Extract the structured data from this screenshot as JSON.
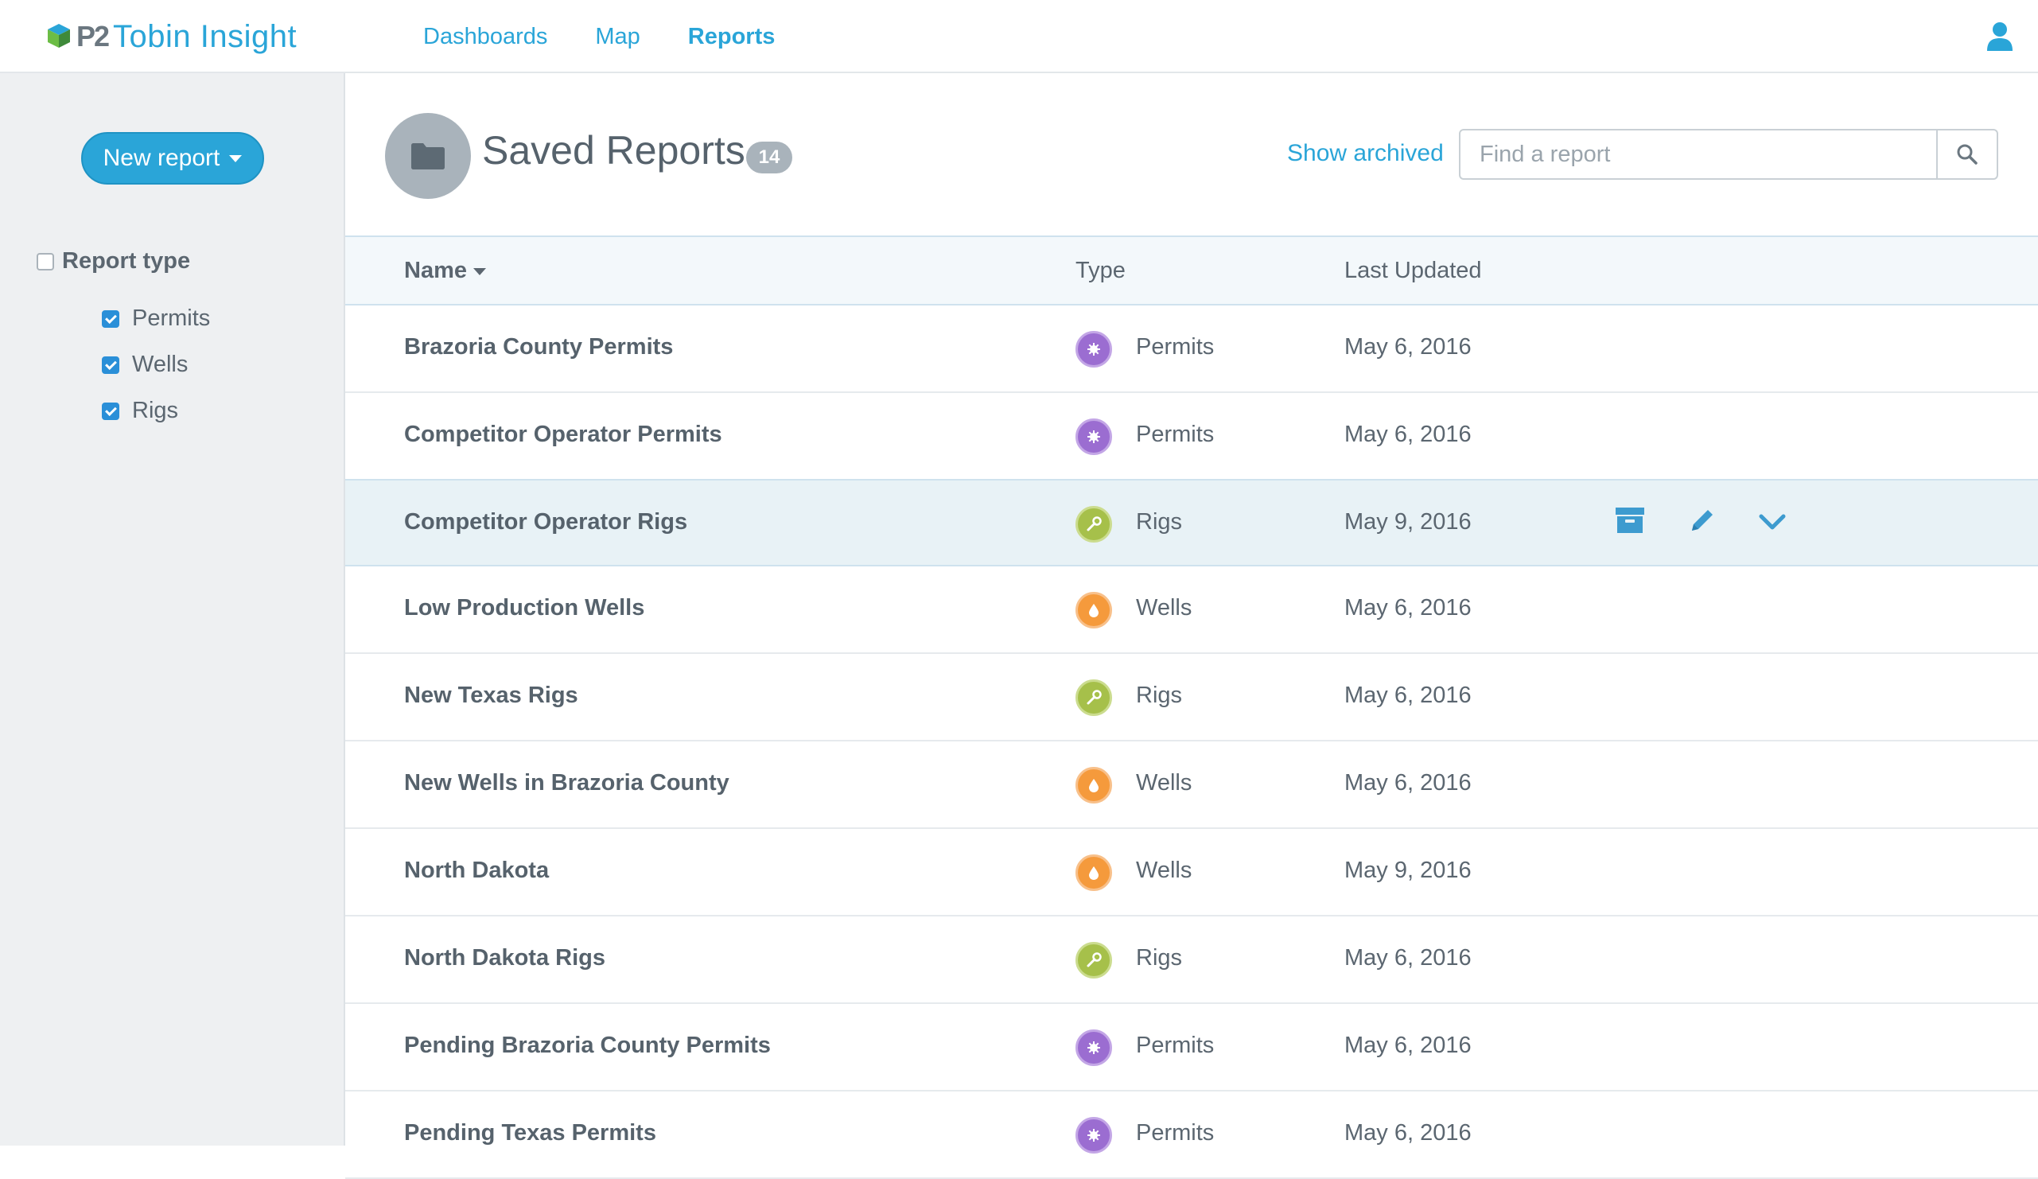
{
  "app": {
    "logo_mark": "P2",
    "logo_name": "Tobin Insight"
  },
  "nav": {
    "items": [
      {
        "label": "Dashboards",
        "active": false
      },
      {
        "label": "Map",
        "active": false
      },
      {
        "label": "Reports",
        "active": true
      }
    ]
  },
  "sidebar": {
    "new_report_label": "New report",
    "filter_title": "Report type",
    "filters": [
      {
        "label": "Permits",
        "checked": true
      },
      {
        "label": "Wells",
        "checked": true
      },
      {
        "label": "Rigs",
        "checked": true
      }
    ]
  },
  "header": {
    "title": "Saved Reports",
    "count": "14",
    "show_archived": "Show archived",
    "search_placeholder": "Find a report"
  },
  "table": {
    "columns": {
      "name": "Name",
      "type": "Type",
      "updated": "Last Updated"
    },
    "rows": [
      {
        "name": "Brazoria County Permits",
        "type": "Permits",
        "updated": "May 6, 2016"
      },
      {
        "name": "Competitor Operator Permits",
        "type": "Permits",
        "updated": "May 6, 2016"
      },
      {
        "name": "Competitor Operator Rigs",
        "type": "Rigs",
        "updated": "May 9, 2016"
      },
      {
        "name": "Low Production Wells",
        "type": "Wells",
        "updated": "May 6, 2016"
      },
      {
        "name": "New Texas Rigs",
        "type": "Rigs",
        "updated": "May 6, 2016"
      },
      {
        "name": "New Wells in Brazoria County",
        "type": "Wells",
        "updated": "May 6, 2016"
      },
      {
        "name": "North Dakota",
        "type": "Wells",
        "updated": "May 9, 2016"
      },
      {
        "name": "North Dakota Rigs",
        "type": "Rigs",
        "updated": "May 6, 2016"
      },
      {
        "name": "Pending Brazoria County Permits",
        "type": "Permits",
        "updated": "May 6, 2016"
      },
      {
        "name": "Pending Texas Permits",
        "type": "Permits",
        "updated": "May 6, 2016"
      }
    ]
  },
  "colors": {
    "accent": "#2aa5d8",
    "permits": "#9b6dd1",
    "rigs": "#a6c04a",
    "wells": "#f59a3c"
  }
}
